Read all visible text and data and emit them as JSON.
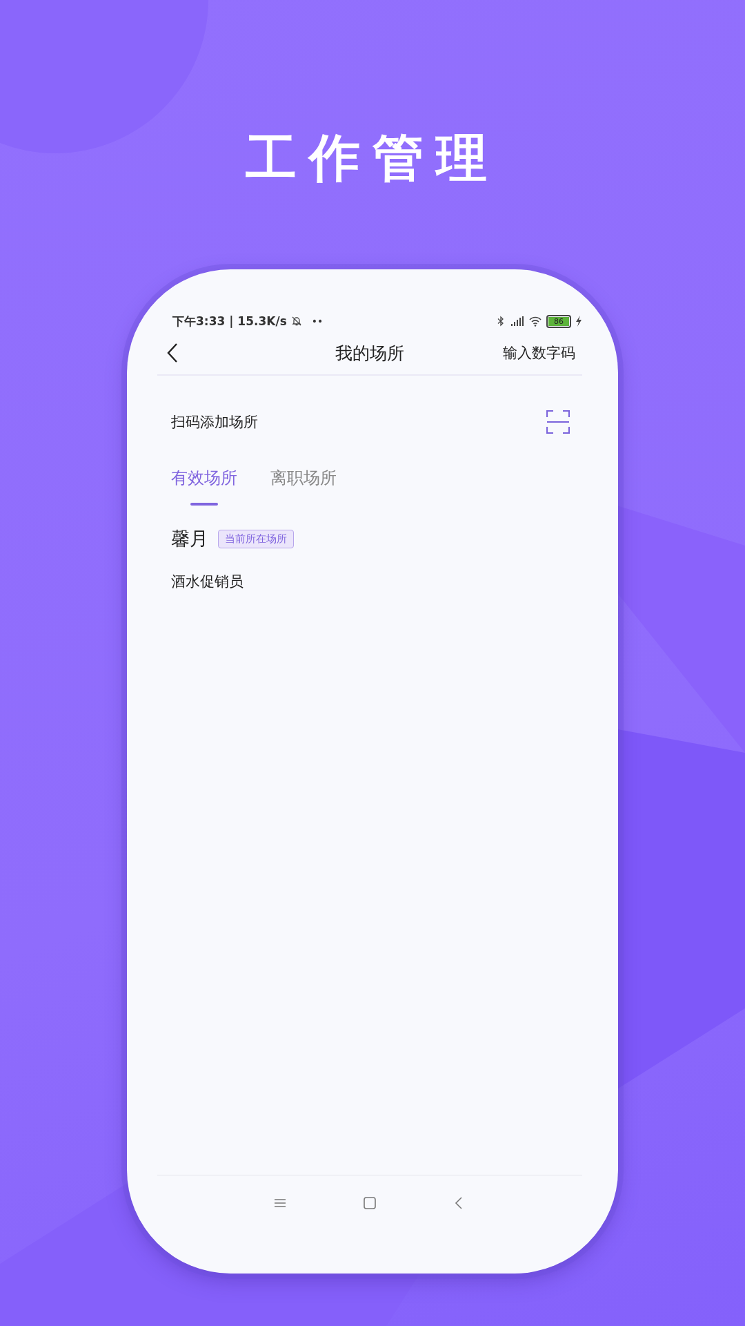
{
  "headline": "工作管理",
  "status_bar": {
    "time": "下午3:33 | 15.3K/s",
    "dots": "••",
    "battery": "86"
  },
  "header": {
    "title": "我的场所",
    "action": "输入数字码"
  },
  "scan_row": {
    "label": "扫码添加场所"
  },
  "tabs": [
    {
      "label": "有效场所",
      "selected": true
    },
    {
      "label": "离职场所",
      "selected": false
    }
  ],
  "venues": [
    {
      "name": "馨月",
      "badge": "当前所在场所",
      "role": "酒水促销员"
    }
  ]
}
